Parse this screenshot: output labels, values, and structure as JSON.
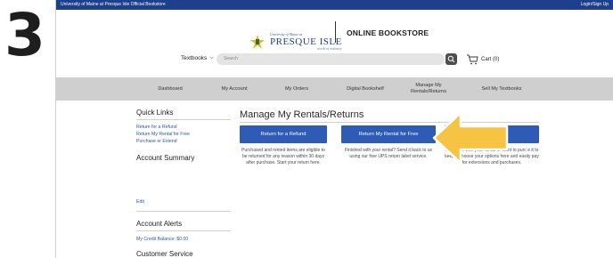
{
  "step": {
    "number": "3"
  },
  "topbar": {
    "left": "University of Maine at Presque Isle Official Bookstore",
    "right": "Login/Sign Up"
  },
  "logo": {
    "small": "University of Maine at",
    "main": "PRESQUE ISLE",
    "tag": "north of ordinary",
    "store_title": "ONLINE BOOKSTORE"
  },
  "searchbar": {
    "textbooks": "Textbooks",
    "placeholder": "Search",
    "cart": "Cart (0)"
  },
  "nav": {
    "items": [
      "Dashboard",
      "My Account",
      "My Orders",
      "Digital Bookshelf",
      "Manage My\nRentals/Returns",
      "Sell My Textbooks"
    ]
  },
  "sidebar": {
    "quick_links_heading": "Quick Links",
    "quick_links": [
      "Return for a Refund",
      "Return My Rental for Free",
      "Purchase or Extend"
    ],
    "account_summary_heading": "Account Summary",
    "edit": "Edit",
    "account_alerts_heading": "Account Alerts",
    "credit_balance": "My Credit Balance: $0.00",
    "customer_service_heading": "Customer Service"
  },
  "main": {
    "title": "Manage My Rentals/Returns",
    "cards": [
      {
        "button": "Return for a Refund",
        "desc": "Purchased and rented items are eligible to be returned for any reason within 30 days after purchase. Start your return here."
      },
      {
        "button": "Return My Rental for Free",
        "desc": "Finished with your rental? Send it back to us using our free UPS return label service."
      },
      {
        "button": "tend",
        "desc": "Ne     a time with your rental or want to purc   e it to keep? Choose your options here and easily pay for extensions and purchases."
      }
    ]
  },
  "colors": {
    "topbar": "#1d3f8c",
    "button": "#2e5bb5",
    "nav": "#cfcfcf",
    "arrow": "#f6c343",
    "link": "#2a55b5"
  },
  "icons": [
    "chevron-down-icon",
    "search-icon",
    "cart-icon",
    "pointer-arrow-icon",
    "logo-emblem-icon"
  ]
}
